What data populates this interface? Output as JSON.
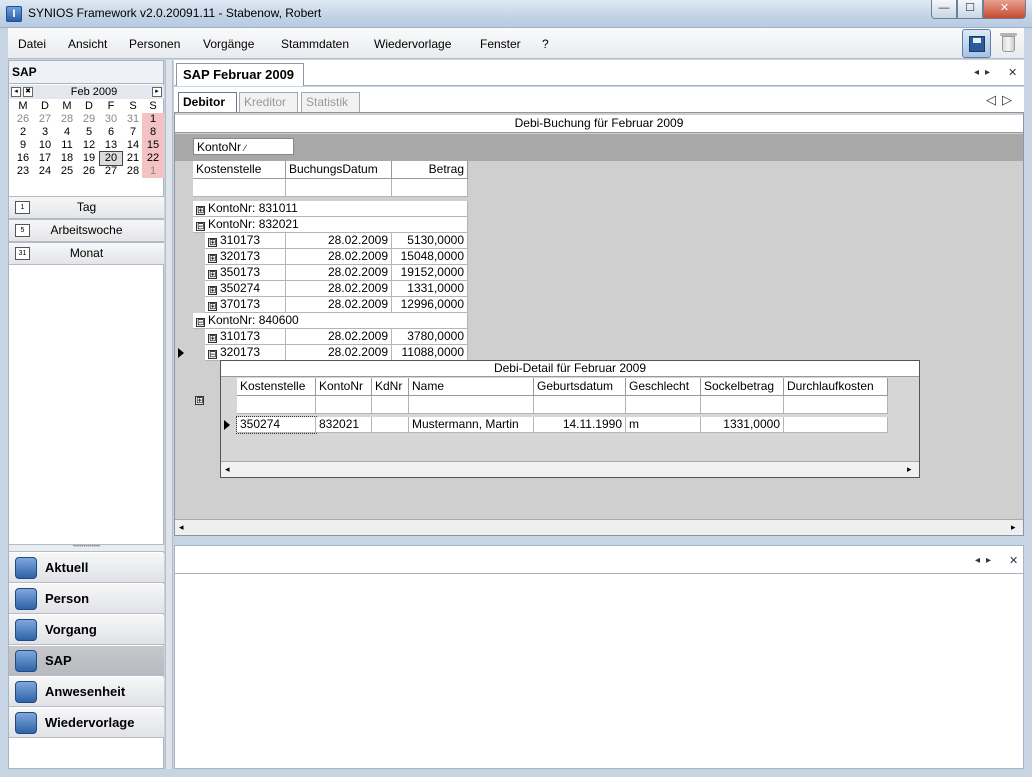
{
  "window": {
    "title": "SYNIOS Framework v2.0.20091.11 - Stabenow, Robert",
    "app_icon": "I",
    "min_glyph": "—",
    "max_glyph": "☐",
    "close_glyph": "✕"
  },
  "menu": [
    "Datei",
    "Ansicht",
    "Personen",
    "Vorgänge",
    "Stammdaten",
    "Wiedervorlage",
    "Fenster",
    "?"
  ],
  "left": {
    "header": "SAP",
    "calendar": {
      "prev_glyph": "◂",
      "close_glyph": "✖",
      "next_glyph": "▸",
      "month_label": "Feb 2009",
      "weekdays": [
        "M",
        "D",
        "M",
        "D",
        "F",
        "S",
        "S"
      ],
      "weeks": [
        [
          "26",
          "27",
          "28",
          "29",
          "30",
          "31",
          "1"
        ],
        [
          "2",
          "3",
          "4",
          "5",
          "6",
          "7",
          "8"
        ],
        [
          "9",
          "10",
          "11",
          "12",
          "13",
          "14",
          "15"
        ],
        [
          "16",
          "17",
          "18",
          "19",
          "20",
          "21",
          "22"
        ],
        [
          "23",
          "24",
          "25",
          "26",
          "27",
          "28",
          "1"
        ]
      ]
    },
    "views": [
      {
        "label": "Tag",
        "icon": "1"
      },
      {
        "label": "Arbeitswoche",
        "icon": "5"
      },
      {
        "label": "Monat",
        "icon": "31"
      }
    ],
    "splitter_grip": "•••••••••••••",
    "nav": [
      {
        "label": "Aktuell",
        "icon": "calendar-icon",
        "active": false
      },
      {
        "label": "Person",
        "icon": "person-icon",
        "active": false
      },
      {
        "label": "Vorgang",
        "icon": "process-icon",
        "active": false
      },
      {
        "label": "SAP",
        "icon": "sap-icon",
        "active": true
      },
      {
        "label": "Anwesenheit",
        "icon": "presence-icon",
        "active": false
      },
      {
        "label": "Wiedervorlage",
        "icon": "reminder-icon",
        "active": false
      }
    ]
  },
  "doc": {
    "tab_label": "SAP Februar 2009",
    "tab_arrows": "◂▸",
    "close_glyph": "✕",
    "sub_tabs": [
      "Debitor",
      "Kreditor",
      "Statistik"
    ],
    "sub_arrows": "◁▷"
  },
  "grid": {
    "title": "Debi-Buchung für Februar 2009",
    "group_chip": "KontoNr",
    "sort_glyph": "∕",
    "columns": [
      "Kostenstelle",
      "BuchungsDatum",
      "Betrag"
    ],
    "expand_glyph": "⊞",
    "collapse_glyph": "⊟",
    "groups": [
      {
        "label": "KontoNr: 831011",
        "expanded": false,
        "rows": []
      },
      {
        "label": "KontoNr: 832021",
        "expanded": true,
        "rows": [
          {
            "kostenstelle": "310173",
            "datum": "28.02.2009",
            "betrag": "5130,0000"
          },
          {
            "kostenstelle": "320173",
            "datum": "28.02.2009",
            "betrag": "15048,0000"
          },
          {
            "kostenstelle": "350173",
            "datum": "28.02.2009",
            "betrag": "19152,0000"
          },
          {
            "kostenstelle": "350274",
            "datum": "28.02.2009",
            "betrag": "1331,0000"
          },
          {
            "kostenstelle": "370173",
            "datum": "28.02.2009",
            "betrag": "12996,0000"
          }
        ]
      },
      {
        "label": "KontoNr: 840600",
        "expanded": true,
        "rows": [
          {
            "kostenstelle": "310173",
            "datum": "28.02.2009",
            "betrag": "3780,0000"
          },
          {
            "kostenstelle": "320173",
            "datum": "28.02.2009",
            "betrag": "11088,0000"
          }
        ]
      }
    ]
  },
  "detail": {
    "title": "Debi-Detail für Februar 2009",
    "columns": [
      "Kostenstelle",
      "KontoNr",
      "KdNr",
      "Name",
      "Geburtsdatum",
      "Geschlecht",
      "Sockelbetrag",
      "Durchlaufkosten"
    ],
    "row": [
      "350274",
      "832021",
      "",
      "Mustermann, Martin",
      "14.11.1990",
      "m",
      "1331,0000",
      ""
    ]
  },
  "scroll": {
    "left": "◂",
    "right": "▸"
  },
  "lower": {
    "arrows": "◂▸",
    "close_glyph": "✕"
  }
}
